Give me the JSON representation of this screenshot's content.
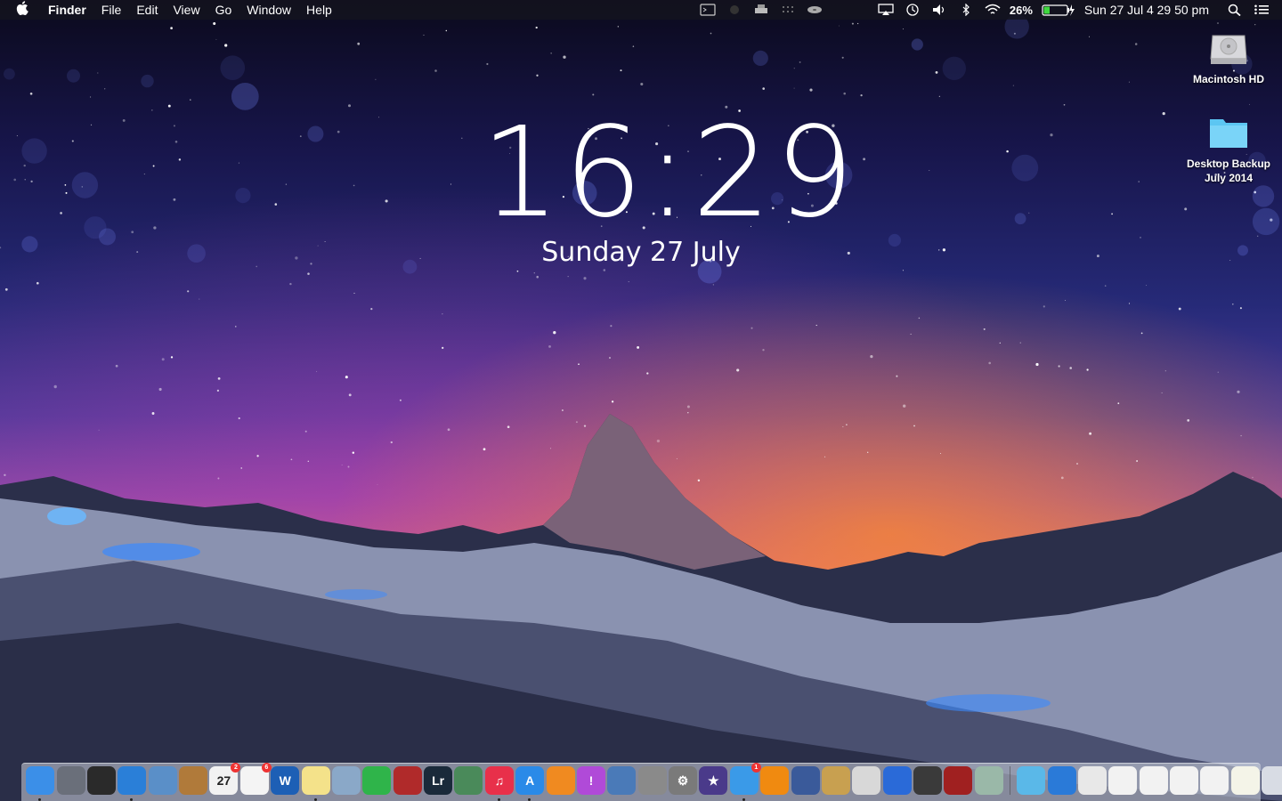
{
  "menubar": {
    "app_name": "Finder",
    "menus": [
      "File",
      "Edit",
      "View",
      "Go",
      "Window",
      "Help"
    ],
    "battery_percent": "26%",
    "datetime": "Sun 27 Jul  4 29 50 pm",
    "icons": [
      "terminal-icon",
      "ghost-icon",
      "printer-icon",
      "grid-icon",
      "disc-icon",
      "airplay-icon",
      "time-machine-icon",
      "volume-icon",
      "bluetooth-icon",
      "wifi-icon",
      "battery-icon",
      "spotlight-icon",
      "notification-center-icon"
    ]
  },
  "battery_level": 0.26,
  "desktop": {
    "icons": [
      {
        "label": "Macintosh HD",
        "icon": "hard-drive-icon"
      },
      {
        "label": "Desktop Backup July 2014",
        "icon": "folder-icon"
      }
    ]
  },
  "clock": {
    "time": "16:29",
    "date": "Sunday 27 July"
  },
  "dock": {
    "apps": [
      {
        "name": "finder",
        "color": "#3b8fe8",
        "label": "",
        "running": true
      },
      {
        "name": "launchpad",
        "color": "#6a6f7a",
        "label": "",
        "running": false
      },
      {
        "name": "mission-control",
        "color": "#2a2a2a",
        "label": "",
        "running": false
      },
      {
        "name": "safari",
        "color": "#2a7fd8",
        "label": "",
        "running": true
      },
      {
        "name": "preview",
        "color": "#5a8fc8",
        "label": "",
        "running": false
      },
      {
        "name": "contacts",
        "color": "#b07a3a",
        "label": "",
        "running": false
      },
      {
        "name": "calendar",
        "color": "#f2f2f2",
        "label": "27",
        "badge": "2",
        "running": false
      },
      {
        "name": "reminders",
        "color": "#f4f4f4",
        "label": "",
        "badge": "6",
        "running": false
      },
      {
        "name": "word",
        "color": "#1d5fb5",
        "label": "W",
        "running": false
      },
      {
        "name": "notes",
        "color": "#f4e28a",
        "label": "",
        "running": true
      },
      {
        "name": "preview-photos",
        "color": "#8aa8c8",
        "label": "",
        "running": false
      },
      {
        "name": "facetime",
        "color": "#2fb44a",
        "label": "",
        "running": false
      },
      {
        "name": "photo-booth",
        "color": "#b02a2a",
        "label": "",
        "running": false
      },
      {
        "name": "lightroom",
        "color": "#1a2a3a",
        "label": "Lr",
        "running": false
      },
      {
        "name": "iphoto",
        "color": "#4a8a5a",
        "label": "",
        "running": false
      },
      {
        "name": "itunes",
        "color": "#e8304a",
        "label": "♫",
        "running": true
      },
      {
        "name": "app-store",
        "color": "#2a8ae8",
        "label": "A",
        "running": true
      },
      {
        "name": "ibooks",
        "color": "#f08a20",
        "label": "",
        "running": false
      },
      {
        "name": "itunes-connect",
        "color": "#b04ad8",
        "label": "!",
        "running": false
      },
      {
        "name": "xcode",
        "color": "#4a7ab8",
        "label": "",
        "running": false
      },
      {
        "name": "archive-utility",
        "color": "#8a8a8a",
        "label": "",
        "running": false
      },
      {
        "name": "system-preferences",
        "color": "#7a7a7a",
        "label": "⚙",
        "running": false
      },
      {
        "name": "imovie",
        "color": "#4a3a8a",
        "label": "★",
        "running": false
      },
      {
        "name": "messages",
        "color": "#3a9ae8",
        "label": "",
        "badge": "1",
        "running": true
      },
      {
        "name": "vlc",
        "color": "#f08a10",
        "label": "",
        "running": false
      },
      {
        "name": "cleanmymac",
        "color": "#3a5a9a",
        "label": "",
        "running": false
      },
      {
        "name": "the-unarchiver",
        "color": "#c8a050",
        "label": "",
        "running": false
      },
      {
        "name": "script-editor",
        "color": "#d8d8d8",
        "label": "",
        "running": false
      },
      {
        "name": "cloudapp",
        "color": "#2a6ad8",
        "label": "",
        "running": false
      },
      {
        "name": "dvd-player",
        "color": "#3a3a3a",
        "label": "",
        "running": false
      },
      {
        "name": "photo-booth-alt",
        "color": "#a02020",
        "label": "",
        "running": false
      },
      {
        "name": "maps",
        "color": "#9ab8a8",
        "label": "",
        "running": false
      }
    ],
    "stacks": [
      {
        "name": "downloads",
        "color": "#5ab8e8"
      },
      {
        "name": "globe",
        "color": "#2a7ad8"
      },
      {
        "name": "document-1",
        "color": "#e8e8e8"
      },
      {
        "name": "document-2",
        "color": "#f2f2f2"
      },
      {
        "name": "document-3",
        "color": "#f2f2f2"
      },
      {
        "name": "document-4",
        "color": "#f2f2f2"
      },
      {
        "name": "document-5",
        "color": "#f2f2f2"
      },
      {
        "name": "document-6",
        "color": "#f4f4e8"
      },
      {
        "name": "trash",
        "color": "#d8dce4"
      }
    ]
  }
}
